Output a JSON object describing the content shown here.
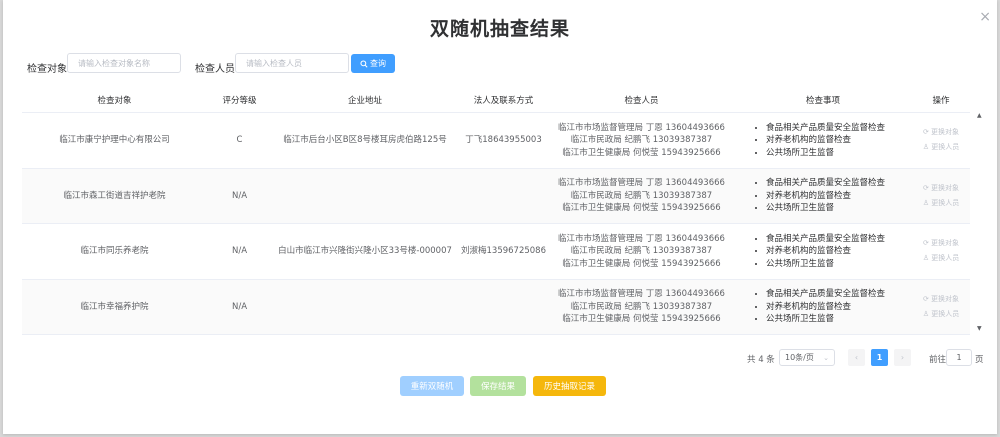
{
  "dialog": {
    "title": "双随机抽查结果",
    "close": "×"
  },
  "filters": {
    "object_label": "检查对象",
    "object_placeholder": "请输入检查对象名称",
    "person_label": "检查人员",
    "person_placeholder": "请输入检查人员",
    "query_label": "查询",
    "query_icon": "search-icon"
  },
  "table": {
    "headers": [
      "检查对象",
      "评分等级",
      "企业地址",
      "法人及联系方式",
      "检查人员",
      "检查事项",
      "操作"
    ],
    "rows": [
      {
        "object": "临江市康宁护理中心有限公司",
        "grade": "C",
        "address": "临江市后台小区B区8号楼耳房虎伯路125号",
        "contact": "丁飞18643955003",
        "inspectors": [
          "临江市市场监督管理局 丁恩 13604493666",
          "临江市民政局 纪鹏飞 13039387387",
          "临江市卫生健康局 何悦莹 15943925666"
        ],
        "items": [
          "食品相关产品质量安全监督检查",
          "对养老机构的监督检查",
          "公共场所卫生监督"
        ],
        "op_change_object": "更换对象",
        "op_change_person": "更换人员"
      },
      {
        "object": "临江市森工街道吉祥护老院",
        "grade": "N/A",
        "address": "",
        "contact": "",
        "inspectors": [
          "临江市市场监督管理局 丁恩 13604493666",
          "临江市民政局 纪鹏飞 13039387387",
          "临江市卫生健康局 何悦莹 15943925666"
        ],
        "items": [
          "食品相关产品质量安全监督检查",
          "对养老机构的监督检查",
          "公共场所卫生监督"
        ],
        "op_change_object": "更换对象",
        "op_change_person": "更换人员"
      },
      {
        "object": "临江市同乐养老院",
        "grade": "N/A",
        "address": "白山市临江市兴隆街兴隆小区33号楼-000007",
        "contact": "刘淑梅13596725086",
        "inspectors": [
          "临江市市场监督管理局 丁恩 13604493666",
          "临江市民政局 纪鹏飞 13039387387",
          "临江市卫生健康局 何悦莹 15943925666"
        ],
        "items": [
          "食品相关产品质量安全监督检查",
          "对养老机构的监督检查",
          "公共场所卫生监督"
        ],
        "op_change_object": "更换对象",
        "op_change_person": "更换人员"
      },
      {
        "object": "临江市幸福养护院",
        "grade": "N/A",
        "address": "",
        "contact": "",
        "inspectors": [
          "临江市市场监督管理局 丁恩 13604493666",
          "临江市民政局 纪鹏飞 13039387387",
          "临江市卫生健康局 何悦莹 15943925666"
        ],
        "items": [
          "食品相关产品质量安全监督检查",
          "对养老机构的监督检查",
          "公共场所卫生监督"
        ],
        "op_change_object": "更换对象",
        "op_change_person": "更换人员"
      }
    ]
  },
  "pagination": {
    "total": "共 4 条",
    "page_size": "10条/页",
    "prev": "‹",
    "current": "1",
    "next": "›",
    "goto_label": "前往",
    "goto_value": "1",
    "page_suffix": "页"
  },
  "actions": {
    "redo": "重新双随机",
    "save": "保存结果",
    "history": "历史抽取记录"
  }
}
